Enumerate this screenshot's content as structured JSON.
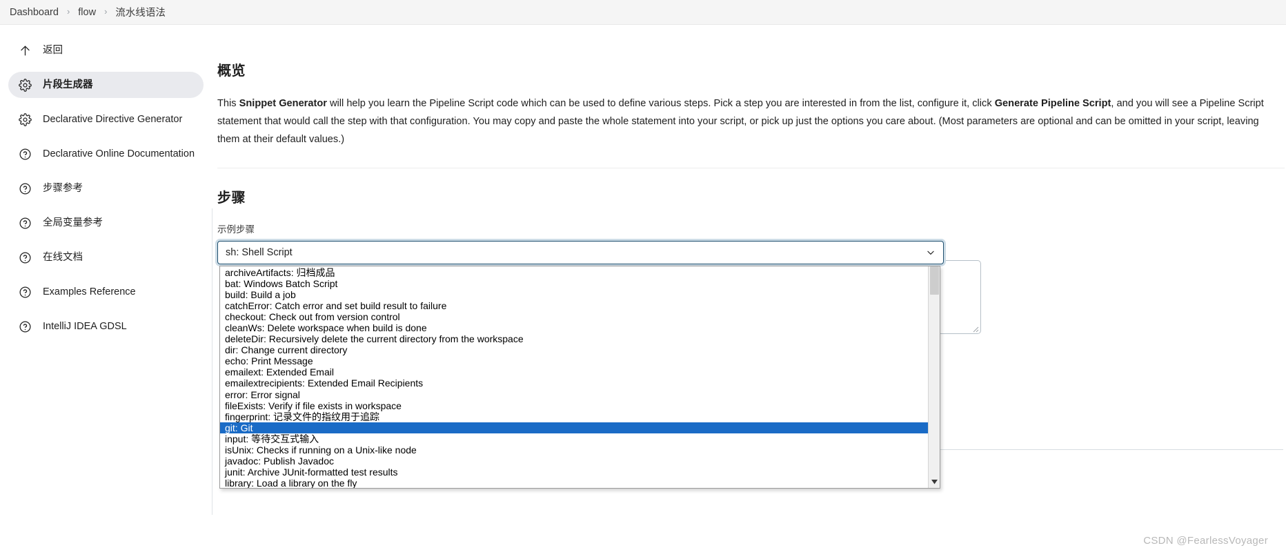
{
  "breadcrumb": {
    "items": [
      {
        "label": "Dashboard"
      },
      {
        "label": "flow"
      },
      {
        "label": "流水线语法"
      }
    ],
    "separator": "›"
  },
  "sidebar": {
    "items": [
      {
        "label": "返回",
        "icon": "arrow-up-icon",
        "active": false
      },
      {
        "label": "片段生成器",
        "icon": "gear-icon",
        "active": true
      },
      {
        "label": "Declarative Directive Generator",
        "icon": "gear-icon",
        "active": false
      },
      {
        "label": "Declarative Online Documentation",
        "icon": "help-icon",
        "active": false
      },
      {
        "label": "步骤参考",
        "icon": "help-icon",
        "active": false
      },
      {
        "label": "全局变量参考",
        "icon": "help-icon",
        "active": false
      },
      {
        "label": "在线文档",
        "icon": "help-icon",
        "active": false
      },
      {
        "label": "Examples Reference",
        "icon": "help-icon",
        "active": false
      },
      {
        "label": "IntelliJ IDEA GDSL",
        "icon": "help-icon",
        "active": false
      }
    ]
  },
  "overview": {
    "title": "概览",
    "text_1": "This ",
    "bold_1": "Snippet Generator",
    "text_2": " will help you learn the Pipeline Script code which can be used to define various steps. Pick a step you are interested in from the list, configure it, click ",
    "bold_2": "Generate Pipeline Script",
    "text_3": ", and you will see a Pipeline Script statement that would call the step with that configuration. You may copy and paste the whole statement into your script, or pick up just the options you care about. (Most parameters are optional and can be omitted in your script, leaving them at their default values.)"
  },
  "steps": {
    "title": "步骤",
    "field_label": "示例步骤",
    "selected_value": "sh: Shell Script",
    "chevron_icon": "chevron-down-icon",
    "options": [
      {
        "label": "archiveArtifacts: 归档成品",
        "selected": false
      },
      {
        "label": "bat: Windows Batch Script",
        "selected": false
      },
      {
        "label": "build: Build a job",
        "selected": false
      },
      {
        "label": "catchError: Catch error and set build result to failure",
        "selected": false
      },
      {
        "label": "checkout: Check out from version control",
        "selected": false
      },
      {
        "label": "cleanWs: Delete workspace when build is done",
        "selected": false
      },
      {
        "label": "deleteDir: Recursively delete the current directory from the workspace",
        "selected": false
      },
      {
        "label": "dir: Change current directory",
        "selected": false
      },
      {
        "label": "echo: Print Message",
        "selected": false
      },
      {
        "label": "emailext: Extended Email",
        "selected": false
      },
      {
        "label": "emailextrecipients: Extended Email Recipients",
        "selected": false
      },
      {
        "label": "error: Error signal",
        "selected": false
      },
      {
        "label": "fileExists: Verify if file exists in workspace",
        "selected": false
      },
      {
        "label": "fingerprint: 记录文件的指纹用于追踪",
        "selected": false
      },
      {
        "label": "git: Git",
        "selected": true
      },
      {
        "label": "input: 等待交互式输入",
        "selected": false
      },
      {
        "label": "isUnix: Checks if running on a Unix-like node",
        "selected": false
      },
      {
        "label": "javadoc: Publish Javadoc",
        "selected": false
      },
      {
        "label": "junit: Archive JUnit-formatted test results",
        "selected": false
      },
      {
        "label": "library: Load a library on the fly",
        "selected": false
      }
    ],
    "scrollbar": {
      "down_arrow_icon": "triangle-down-icon"
    }
  },
  "watermark": {
    "text": "CSDN @FearlessVoyager"
  }
}
